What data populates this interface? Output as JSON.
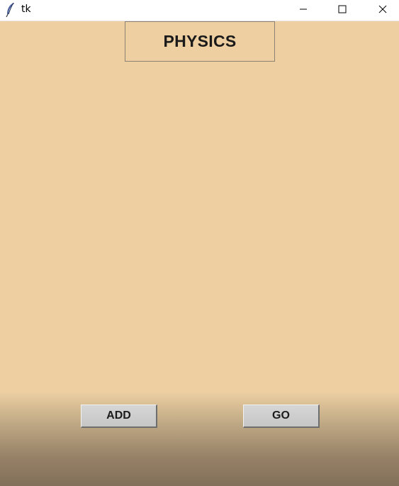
{
  "window": {
    "title": "tk",
    "background": "#EDCFA2",
    "icon": "feather-icon",
    "controls": [
      "minimize-icon",
      "maximize-icon",
      "close-icon"
    ]
  },
  "main": {
    "subject_label": "PHYSICS"
  },
  "buttons": {
    "add_label": "ADD",
    "go_label": "GO"
  }
}
